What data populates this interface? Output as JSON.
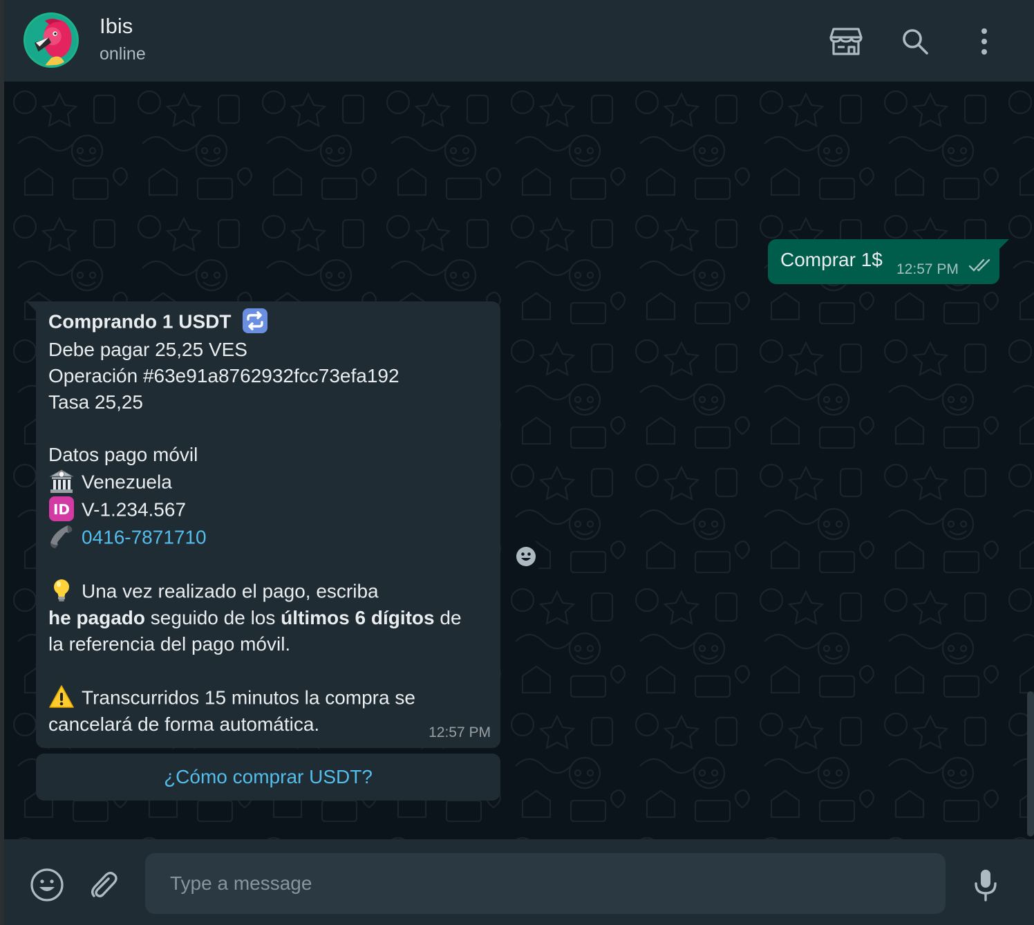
{
  "header": {
    "contact_name": "Ibis",
    "status": "online",
    "icons": [
      "store-icon",
      "search-icon",
      "more-vertical-icon"
    ]
  },
  "messages": {
    "outgoing": {
      "text": "Comprar 1$",
      "time": "12:57 PM",
      "status": "read"
    },
    "incoming": {
      "title": "Comprando 1 USDT",
      "line_amount": "Debe pagar 25,25 VES",
      "line_operation": "Operación #63e91a8762932fcc73efa192",
      "line_rate": "Tasa 25,25",
      "section_title": "Datos pago móvil",
      "bank": "Venezuela",
      "id_number": "V-1.234.567",
      "phone": "0416-7871710",
      "tip_part1": "Una vez realizado el pago, escriba",
      "tip_bold1": "he pagado",
      "tip_part2": " seguido de los ",
      "tip_bold2": "últimos 6 dígitos",
      "tip_part3": " de",
      "tip_line3": "la referencia del pago móvil.",
      "warn_line1": "Transcurridos 15 minutos la compra se",
      "warn_line2": "cancelará de forma automática.",
      "time": "12:57 PM"
    },
    "quick_reply": "¿Cómo comprar USDT?"
  },
  "composer": {
    "placeholder": "Type a message"
  },
  "colors": {
    "header_bg": "#202c33",
    "chat_bg": "#0b141a",
    "outgoing_bubble": "#005c4b",
    "incoming_bubble": "#202c33",
    "link": "#53bdeb",
    "input_bg": "#2a3942"
  }
}
